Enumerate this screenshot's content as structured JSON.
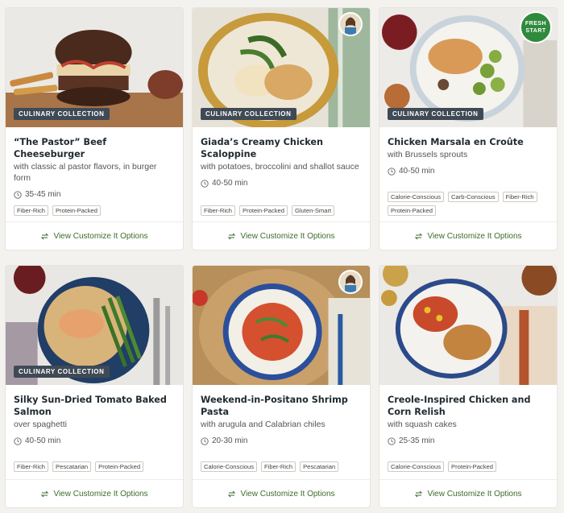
{
  "recipes": [
    {
      "title": "“The Pastor” Beef Cheeseburger",
      "subtitle": "with classic al pastor flavors, in burger form",
      "time": "35-45 min",
      "badge": "CULINARY COLLECTION",
      "tags": [
        "Fiber-Rich",
        "Protein-Packed"
      ],
      "cta": "View Customize It Options"
    },
    {
      "title": "Giada’s Creamy Chicken Scaloppine",
      "subtitle": "with potatoes, broccolini and shallot sauce",
      "time": "40-50 min",
      "badge": "CULINARY COLLECTION",
      "tags": [
        "Fiber-Rich",
        "Protein-Packed",
        "Gluten-Smart"
      ],
      "cta": "View Customize It Options"
    },
    {
      "title": "Chicken Marsala en Croûte",
      "subtitle": "with Brussels sprouts",
      "time": "40-50 min",
      "badge": "CULINARY COLLECTION",
      "fresh_start": "FRESH START",
      "tags": [
        "Calorie-Conscious",
        "Carb-Conscious",
        "Fiber-Rich",
        "Protein-Packed"
      ],
      "cta": "View Customize It Options"
    },
    {
      "title": "Silky Sun-Dried Tomato Baked Salmon",
      "subtitle": "over spaghetti",
      "time": "40-50 min",
      "badge": "CULINARY COLLECTION",
      "tags": [
        "Fiber-Rich",
        "Pescatarian",
        "Protein-Packed"
      ],
      "cta": "View Customize It Options"
    },
    {
      "title": "Weekend-in-Positano Shrimp Pasta",
      "subtitle": "with arugula and Calabrian chiles",
      "time": "20-30 min",
      "tags": [
        "Calorie-Conscious",
        "Fiber-Rich",
        "Pescatarian"
      ],
      "cta": "View Customize It Options"
    },
    {
      "title": "Creole-Inspired Chicken and Corn Relish",
      "subtitle": "with squash cakes",
      "time": "25-35 min",
      "tags": [
        "Calorie-Conscious",
        "Protein-Packed"
      ],
      "cta": "View Customize It Options"
    }
  ],
  "colors": {
    "accent_green": "#3d6b2b",
    "badge_bg": "#3f4a55",
    "fresh_start_green": "#2f8a3c"
  },
  "icons": {
    "time": "clock-icon",
    "cta": "swap-arrows-icon"
  }
}
